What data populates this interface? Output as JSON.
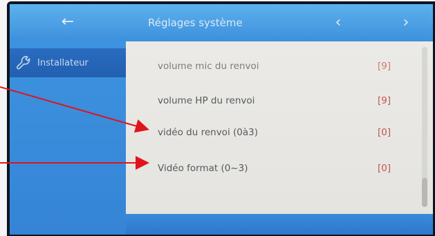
{
  "header": {
    "title": "Réglages système",
    "back_icon": "arrow-left-icon",
    "prev_icon": "chevron-left-icon",
    "next_icon": "chevron-right-icon"
  },
  "sidebar": {
    "items": [
      {
        "label": "Installateur",
        "icon": "wrench-icon",
        "selected": true
      }
    ]
  },
  "settings": {
    "rows": [
      {
        "label": "volume mic du renvoi",
        "value": "[9]"
      },
      {
        "label": "volume HP du renvoi",
        "value": "[9]"
      },
      {
        "label": "vidéo du renvoi (0à3)",
        "value": "[0]"
      },
      {
        "label": "Vidéo format (0~3)",
        "value": "[0]"
      }
    ]
  },
  "annotations": {
    "arrow_color": "#e0141b"
  },
  "colors": {
    "accent": "#3d90dc",
    "value_red": "#c2554d"
  }
}
